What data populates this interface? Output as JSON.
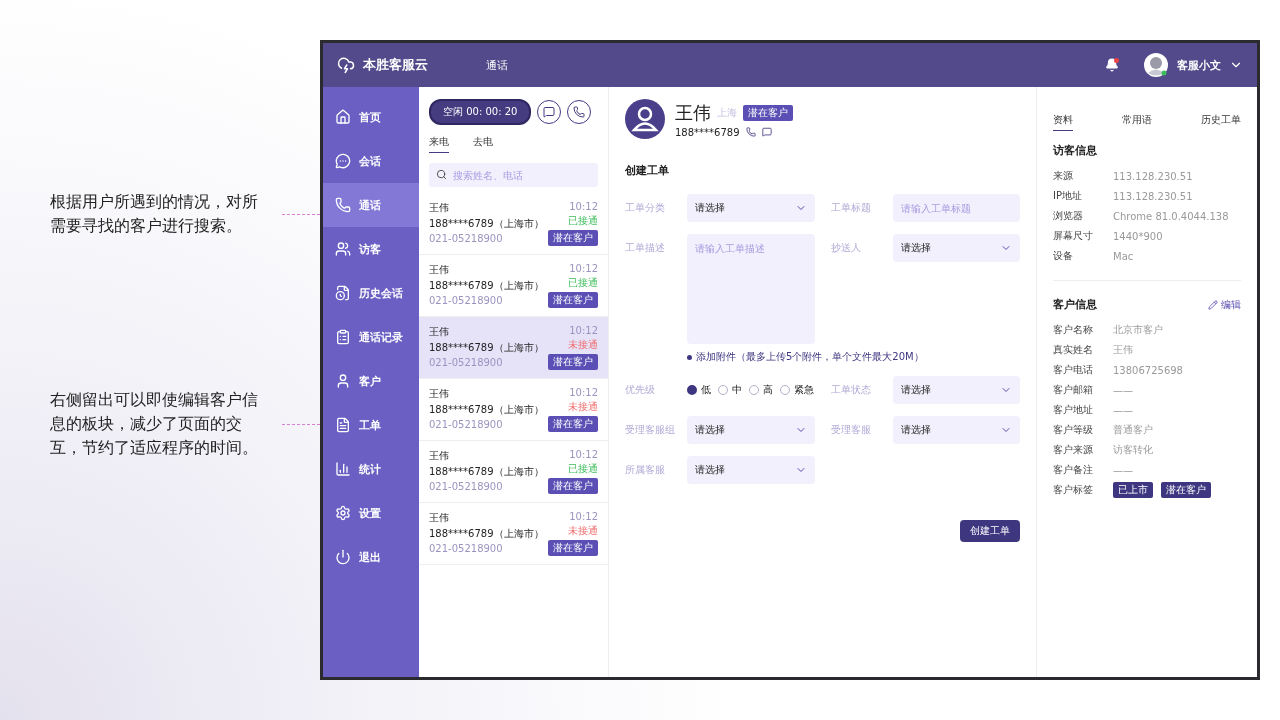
{
  "annotations": [
    {
      "text": "根据用户所遇到的情况，对所需要寻找的客户进行搜索。"
    },
    {
      "text": "右侧留出可以即使编辑客户信息的板块，减少了页面的交互，节约了适应程序的时间。"
    }
  ],
  "app": {
    "brand": "本胜客服云",
    "top_nav": "通话",
    "user": "客服小文",
    "sidebar": [
      {
        "label": "首页",
        "selected": false
      },
      {
        "label": "会话",
        "selected": false
      },
      {
        "label": "通话",
        "selected": true
      },
      {
        "label": "访客",
        "selected": false
      },
      {
        "label": "历史会话",
        "selected": false
      },
      {
        "label": "通话记录",
        "selected": false
      },
      {
        "label": "客户",
        "selected": false
      },
      {
        "label": "工单",
        "selected": false
      },
      {
        "label": "统计",
        "selected": false
      },
      {
        "label": "设置",
        "selected": false
      },
      {
        "label": "退出",
        "selected": false
      }
    ],
    "call_status": "空闲 00: 00: 20",
    "call_tabs": [
      {
        "label": "来电",
        "selected": true
      },
      {
        "label": "去电",
        "selected": false
      }
    ],
    "search": {
      "placeholder": "搜索姓名、电话"
    },
    "calls": [
      {
        "name": "王伟",
        "phone": "188****6789（上海市）",
        "number": "021-05218900",
        "time": "10:12",
        "status": "已接通",
        "kind": "connected",
        "tag": "潜在客户",
        "selected": false
      },
      {
        "name": "王伟",
        "phone": "188****6789（上海市）",
        "number": "021-05218900",
        "time": "10:12",
        "status": "已接通",
        "kind": "connected",
        "tag": "潜在客户",
        "selected": false
      },
      {
        "name": "王伟",
        "phone": "188****6789（上海市）",
        "number": "021-05218900",
        "time": "10:12",
        "status": "未接通",
        "kind": "missed",
        "tag": "潜在客户",
        "selected": true
      },
      {
        "name": "王伟",
        "phone": "188****6789（上海市）",
        "number": "021-05218900",
        "time": "10:12",
        "status": "未接通",
        "kind": "missed",
        "tag": "潜在客户",
        "selected": false
      },
      {
        "name": "王伟",
        "phone": "188****6789（上海市）",
        "number": "021-05218900",
        "time": "10:12",
        "status": "已接通",
        "kind": "connected",
        "tag": "潜在客户",
        "selected": false
      },
      {
        "name": "王伟",
        "phone": "188****6789（上海市）",
        "number": "021-05218900",
        "time": "10:12",
        "status": "未接通",
        "kind": "missed",
        "tag": "潜在客户",
        "selected": false
      }
    ],
    "customer": {
      "name": "王伟",
      "city": "上海",
      "tag": "潜在客户",
      "phone": "188****6789"
    },
    "ticket_form": {
      "title": "创建工单",
      "fields": [
        {
          "label": "工单分类",
          "kind": "select",
          "value": "请选择"
        },
        {
          "label": "工单标题",
          "kind": "input",
          "placeholder": "请输入工单标题"
        },
        {
          "label": "工单描述",
          "kind": "textarea",
          "placeholder": "请输入工单描述",
          "note": "添加附件（最多上传5个附件，单个文件最大20M）"
        },
        {
          "label": "抄送人",
          "kind": "select",
          "value": "请选择"
        },
        {
          "label": "优先级",
          "kind": "radio",
          "options": [
            {
              "label": "低",
              "selected": true
            },
            {
              "label": "中",
              "selected": false
            },
            {
              "label": "高",
              "selected": false
            },
            {
              "label": "紧急",
              "selected": false
            }
          ]
        },
        {
          "label": "工单状态",
          "kind": "select",
          "value": "请选择"
        },
        {
          "label": "受理客服组",
          "kind": "select",
          "value": "请选择"
        },
        {
          "label": "受理客服",
          "kind": "select",
          "value": "请选择"
        },
        {
          "label": "所属客服",
          "kind": "select",
          "value": "请选择"
        }
      ],
      "submit": "创建工单"
    },
    "info_panel": {
      "tabs": [
        {
          "label": "资料",
          "selected": true
        },
        {
          "label": "常用语",
          "selected": false
        },
        {
          "label": "历史工单",
          "selected": false
        }
      ],
      "visitor": {
        "title": "访客信息",
        "rows": [
          {
            "label": "来源",
            "value": "113.128.230.51"
          },
          {
            "label": "IP地址",
            "value": "113.128.230.51"
          },
          {
            "label": "浏览器",
            "value": "Chrome 81.0.4044.138"
          },
          {
            "label": "屏幕尺寸",
            "value": "1440*900"
          },
          {
            "label": "设备",
            "value": "Mac"
          }
        ]
      },
      "customer": {
        "title": "客户信息",
        "edit": "编辑",
        "rows": [
          {
            "label": "客户名称",
            "value": "北京市客户"
          },
          {
            "label": "真实姓名",
            "value": "王伟"
          },
          {
            "label": "客户电话",
            "value": "13806725698"
          },
          {
            "label": "客户邮箱",
            "value": "——"
          },
          {
            "label": "客户地址",
            "value": "——"
          },
          {
            "label": "客户等级",
            "value": "普通客户"
          },
          {
            "label": "客户来源",
            "value": "访客转化"
          },
          {
            "label": "客户备注",
            "value": "——"
          }
        ],
        "tags_label": "客户标签",
        "tags": [
          "已上市",
          "潜在客户"
        ]
      }
    }
  }
}
